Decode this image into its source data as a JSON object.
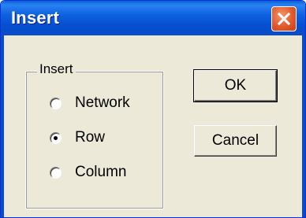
{
  "window": {
    "title": "Insert",
    "close_icon": "close-icon"
  },
  "group": {
    "label": "Insert",
    "options": [
      {
        "label": "Network",
        "checked": false
      },
      {
        "label": "Row",
        "checked": true
      },
      {
        "label": "Column",
        "checked": false
      }
    ]
  },
  "buttons": {
    "ok_label": "OK",
    "cancel_label": "Cancel"
  },
  "colors": {
    "titlebar": "#0550d0",
    "dialog_bg": "#ece9d8",
    "close_button": "#e2582b"
  }
}
